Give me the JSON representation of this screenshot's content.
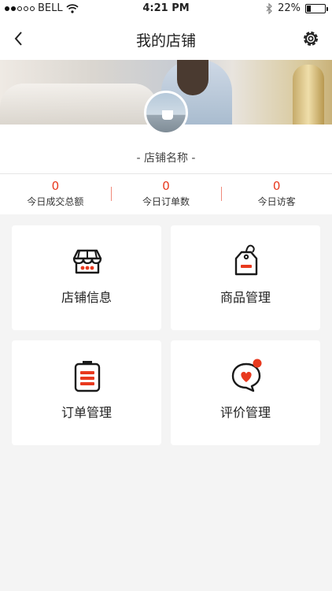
{
  "status_bar": {
    "carrier": "BELL",
    "time": "4:21 PM",
    "battery": "22%"
  },
  "nav": {
    "title": "我的店铺"
  },
  "profile": {
    "shop_name": "- 店铺名称 -"
  },
  "stats": [
    {
      "value": "0",
      "label": "今日成交总额"
    },
    {
      "value": "0",
      "label": "今日订单数"
    },
    {
      "value": "0",
      "label": "今日访客"
    }
  ],
  "menu": [
    {
      "label": "店铺信息",
      "icon": "store-icon"
    },
    {
      "label": "商品管理",
      "icon": "tag-icon"
    },
    {
      "label": "订单管理",
      "icon": "clipboard-icon"
    },
    {
      "label": "评价管理",
      "icon": "heart-chat-icon"
    }
  ],
  "colors": {
    "accent": "#e8391e",
    "dark": "#1a1a1a",
    "background": "#f4f4f4"
  }
}
